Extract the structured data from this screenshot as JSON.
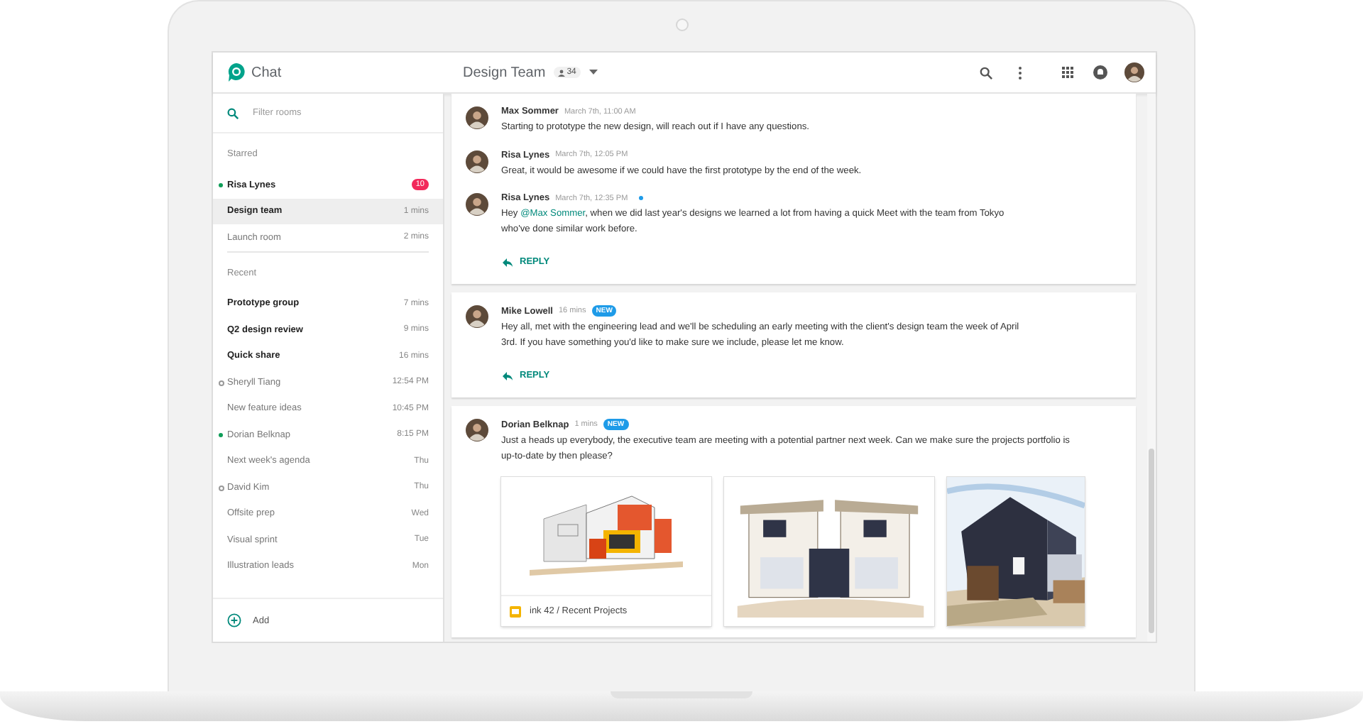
{
  "app": {
    "name": "Chat"
  },
  "room": {
    "title": "Design Team",
    "members": "34"
  },
  "sidebar": {
    "filter": {
      "placeholder": "Filter rooms"
    },
    "sections": [
      {
        "title": "Starred",
        "items": [
          {
            "name": "Risa Lynes",
            "unread": true,
            "online": true,
            "offline": false,
            "badge": "10",
            "selected": false
          },
          {
            "name": "Design team",
            "time": "1 mins",
            "unread": true,
            "online": false,
            "offline": false,
            "selected": true
          },
          {
            "name": "Launch room",
            "time": "2 mins",
            "unread": false,
            "online": false,
            "offline": false,
            "selected": false
          }
        ]
      },
      {
        "title": "Recent",
        "items": [
          {
            "name": "Prototype group",
            "time": "7 mins",
            "unread": true,
            "online": false,
            "offline": false,
            "selected": false
          },
          {
            "name": "Q2 design review",
            "time": "9 mins",
            "unread": true,
            "online": false,
            "offline": false,
            "selected": false
          },
          {
            "name": "Quick share",
            "time": "16 mins",
            "unread": true,
            "online": false,
            "offline": false,
            "selected": false
          },
          {
            "name": "Sheryll Tiang",
            "time": "12:54 PM",
            "unread": false,
            "online": false,
            "offline": true,
            "selected": false
          },
          {
            "name": "New feature ideas",
            "time": "10:45 PM",
            "unread": false,
            "online": false,
            "offline": false,
            "selected": false
          },
          {
            "name": "Dorian Belknap",
            "time": "8:15 PM",
            "unread": false,
            "online": true,
            "offline": false,
            "selected": false
          },
          {
            "name": "Next week's agenda",
            "time": "Thu",
            "unread": false,
            "online": false,
            "offline": false,
            "selected": false
          },
          {
            "name": "David Kim",
            "time": "Thu",
            "unread": false,
            "online": false,
            "offline": true,
            "selected": false
          },
          {
            "name": "Offsite prep",
            "time": "Wed",
            "unread": false,
            "online": false,
            "offline": false,
            "selected": false
          },
          {
            "name": "Visual sprint",
            "time": "Tue",
            "unread": false,
            "online": false,
            "offline": false,
            "selected": false
          },
          {
            "name": "Illustration leads",
            "time": "Mon",
            "unread": false,
            "online": false,
            "offline": false,
            "selected": false
          }
        ]
      }
    ],
    "add": "Add"
  },
  "threads": [
    {
      "messages": [
        {
          "author": "Max Sommer",
          "time": "March 7th, 11:00 AM",
          "unread": false,
          "parts": [
            {
              "kind": "text",
              "text": "Starting to prototype the new design, will reach out if I have any questions."
            }
          ]
        },
        {
          "author": "Risa Lynes",
          "time": "March 7th, 12:05 PM",
          "unread": false,
          "parts": [
            {
              "kind": "text",
              "text": "Great, it would be awesome if we could have the first prototype by the end of the week."
            }
          ]
        },
        {
          "author": "Risa Lynes",
          "time": "March 7th, 12:35 PM",
          "unread": true,
          "parts": [
            {
              "kind": "text",
              "text": "Hey "
            },
            {
              "kind": "mention",
              "text": "@Max Sommer"
            },
            {
              "kind": "text",
              "text": ", when we did last year's designs we learned a lot from having a quick Meet with the team from Tokyo who've done similar work before."
            }
          ]
        }
      ],
      "reply": "REPLY"
    },
    {
      "messages": [
        {
          "author": "Mike Lowell",
          "time": "16 mins",
          "badge": "NEW",
          "unread": false,
          "parts": [
            {
              "kind": "text",
              "text": "Hey all, met with the engineering lead and we'll be scheduling an early meeting with the client's design team the week of April 3rd. If you have something you'd like to make sure we include, please let me know."
            }
          ]
        }
      ],
      "reply": "REPLY"
    },
    {
      "messages": [
        {
          "author": "Dorian Belknap",
          "time": "1 mins",
          "badge": "NEW",
          "unread": false,
          "parts": [
            {
              "kind": "text",
              "text": "Just a heads up everybody, the executive team are meeting with a potential partner next week. Can we make sure the projects portfolio is up-to-date by then please?"
            }
          ],
          "attachments": [
            {
              "kind": "file",
              "caption": "ink 42 / Recent Projects"
            },
            {
              "kind": "picture"
            },
            {
              "kind": "picture"
            }
          ]
        }
      ]
    }
  ]
}
